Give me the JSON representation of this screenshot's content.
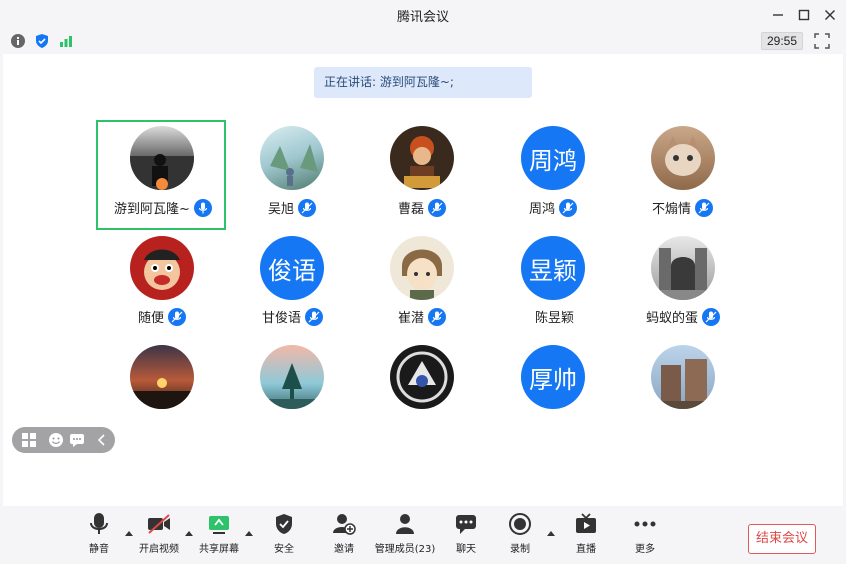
{
  "window": {
    "title": "腾讯会议"
  },
  "meeting": {
    "timer": "29:55",
    "speaking_text": "正在讲话: 游到阿瓦隆~;"
  },
  "participants": [
    {
      "name": "游到阿瓦隆~",
      "avatar": "photo",
      "active": true
    },
    {
      "name": "吴旭",
      "avatar": "photo"
    },
    {
      "name": "曹磊",
      "avatar": "photo"
    },
    {
      "name": "周鸿",
      "avatar": "text",
      "avatar_text": "周鸿"
    },
    {
      "name": "不煽情",
      "avatar": "photo"
    },
    {
      "name": "随便",
      "avatar": "photo"
    },
    {
      "name": "甘俊语",
      "avatar": "text",
      "avatar_text": "俊语"
    },
    {
      "name": "崔潜",
      "avatar": "photo"
    },
    {
      "name": "陈昱颖",
      "avatar": "text",
      "avatar_text": "昱颖"
    },
    {
      "name": "蚂蚁的蛋",
      "avatar": "photo"
    },
    {
      "name": "",
      "avatar": "photo"
    },
    {
      "name": "",
      "avatar": "photo"
    },
    {
      "name": "",
      "avatar": "photo"
    },
    {
      "name": "",
      "avatar": "text",
      "avatar_text": "厚帅"
    },
    {
      "name": "",
      "avatar": "photo"
    }
  ],
  "toolbar": {
    "mute": "静音",
    "video": "开启视频",
    "share": "共享屏幕",
    "security": "安全",
    "invite": "邀请",
    "members": "管理成员(23)",
    "chat": "聊天",
    "record": "录制",
    "live": "直播",
    "more": "更多",
    "end": "结束会议"
  },
  "colors": {
    "accent": "#1677f5",
    "active_border": "#2ec26b",
    "end_red": "#e04848"
  }
}
